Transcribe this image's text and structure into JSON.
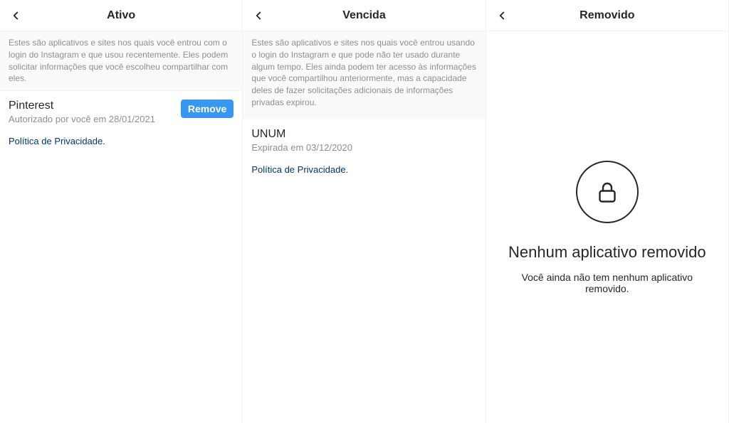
{
  "panes": {
    "active": {
      "title": "Ativo",
      "description": "Estes são aplicativos e sites nos quais você entrou com o login do Instagram e que usou recentemente. Eles podem solicitar informações que você escolheu compartilhar com eles.",
      "app": {
        "name": "Pinterest",
        "sub": "Autorizado por você em 28/01/2021"
      },
      "remove_label": "Remove",
      "policy": "Política de Privacidade."
    },
    "expired": {
      "title": "Vencida",
      "description": "Estes são aplicativos e sites nos quais você entrou usando o login do Instagram e que pode não ter usado durante algum tempo. Eles ainda podem ter acesso às informações que você compartilhou anteriormente, mas a capacidade deles de fazer solicitações adicionais de informações privadas expirou.",
      "app": {
        "name": "UNUM",
        "sub": "Expirada em 03/12/2020"
      },
      "policy": "Política de Privacidade."
    },
    "removed": {
      "title": "Removido",
      "empty_title": "Nenhum aplicativo removido",
      "empty_sub": "Você ainda não tem nenhum aplicativo removido."
    }
  }
}
